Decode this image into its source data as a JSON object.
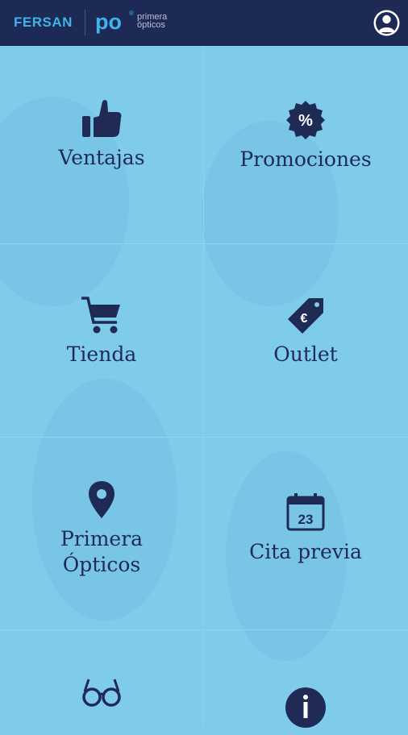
{
  "header": {
    "brand": "FERSAN",
    "logo_po": "po",
    "logo_sup": "®",
    "logo_line1": "primera",
    "logo_line2": "ópticos",
    "profile_icon": "user-profile-icon"
  },
  "menu": {
    "items": [
      {
        "label": "Ventajas",
        "icon": "thumbs-up-icon"
      },
      {
        "label": "Promociones",
        "icon": "percent-badge-icon"
      },
      {
        "label": "Tienda",
        "icon": "shopping-cart-icon"
      },
      {
        "label": "Outlet",
        "icon": "euro-tag-icon"
      },
      {
        "label1": "Primera",
        "label2": "Ópticos",
        "icon": "location-pin-icon"
      },
      {
        "label": "Cita previa",
        "icon": "calendar-icon",
        "date": "23"
      },
      {
        "icon": "glasses-icon"
      },
      {
        "icon": "info-icon"
      }
    ]
  },
  "colors": {
    "header_bg": "#1d2a55",
    "accent": "#3fb3ea",
    "content_bg": "#7ecbea",
    "icon_text": "#1f2a55"
  }
}
